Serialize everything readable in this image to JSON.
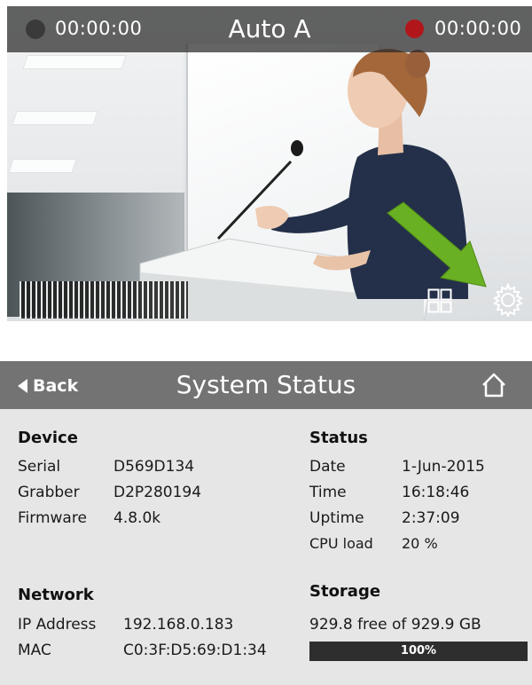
{
  "video": {
    "timecode_left": "00:00:00",
    "source_name": "Auto A",
    "timecode_right": "00:00:00",
    "record_color": "#b0161a",
    "layout_icon": "grid-layout-icon",
    "settings_icon": "gear-icon",
    "annotation_arrow_color": "#6ab023"
  },
  "status_page": {
    "back_label": "Back",
    "title": "System Status",
    "home_icon": "home-icon",
    "device": {
      "heading": "Device",
      "rows": [
        {
          "label": "Serial",
          "value": "D569D134"
        },
        {
          "label": "Grabber",
          "value": "D2P280194"
        },
        {
          "label": "Firmware",
          "value": "4.8.0k"
        }
      ]
    },
    "status": {
      "heading": "Status",
      "rows": [
        {
          "label": "Date",
          "value": "1-Jun-2015"
        },
        {
          "label": "Time",
          "value": "16:18:46"
        },
        {
          "label": "Uptime",
          "value": "2:37:09"
        },
        {
          "label": "CPU load",
          "value": "20 %"
        }
      ]
    },
    "network": {
      "heading": "Network",
      "rows": [
        {
          "label": "IP Address",
          "value": "192.168.0.183"
        },
        {
          "label": "MAC",
          "value": "C0:3F:D5:69:D1:34"
        }
      ]
    },
    "storage": {
      "heading": "Storage",
      "summary": "929.8 free of 929.9 GB",
      "percent_label": "100%",
      "fill_fraction": 1.0
    }
  }
}
